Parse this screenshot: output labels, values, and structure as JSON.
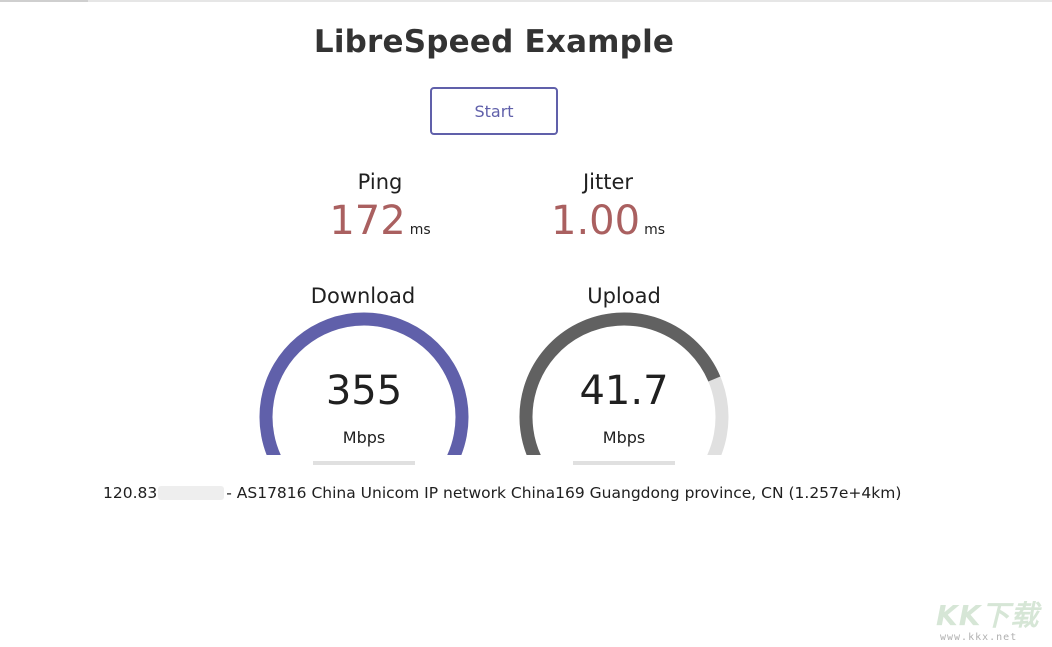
{
  "page": {
    "title": "LibreSpeed Example",
    "start_label": "Start"
  },
  "ping": {
    "label": "Ping",
    "value": "172",
    "unit": "ms"
  },
  "jitter": {
    "label": "Jitter",
    "value": "1.00",
    "unit": "ms"
  },
  "download": {
    "label": "Download",
    "value": "355",
    "unit": "Mbps",
    "gauge_fraction": 1.0,
    "color": "#6060aa",
    "track_color": "#e0e0e0"
  },
  "upload": {
    "label": "Upload",
    "value": "41.7",
    "unit": "Mbps",
    "gauge_fraction": 0.78,
    "color": "#616161",
    "track_color": "#e0e0e0"
  },
  "ip_info": {
    "ip_prefix": "120.83",
    "details": "- AS17816 China Unicom IP network China169 Guangdong province, CN (1.257e+4km)"
  },
  "watermark": {
    "logo_text": "KK下载",
    "url": "www.kkx.net"
  },
  "colors": {
    "accent": "#6060aa",
    "value_red": "#aa6060"
  }
}
